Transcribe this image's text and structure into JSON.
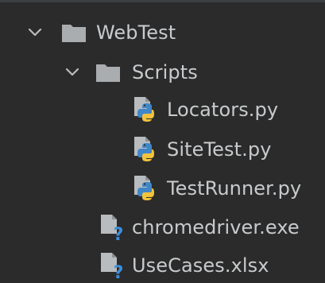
{
  "tree": {
    "root": {
      "label": "WebTest",
      "expanded": true,
      "icon": "folder-icon",
      "children": [
        {
          "label": "Scripts",
          "expanded": true,
          "icon": "folder-icon",
          "children": [
            {
              "label": "Locators.py",
              "icon": "python-file-icon"
            },
            {
              "label": "SiteTest.py",
              "icon": "python-file-icon"
            },
            {
              "label": "TestRunner.py",
              "icon": "python-file-icon"
            }
          ]
        },
        {
          "label": "chromedriver.exe",
          "icon": "unknown-file-icon"
        },
        {
          "label": "UseCases.xlsx",
          "icon": "unknown-file-icon"
        }
      ]
    }
  },
  "colors": {
    "background": "#2b2b2b",
    "text": "#c8cbcd",
    "folder": "#a9adb0",
    "python_blue": "#3f86c8",
    "python_yellow": "#f2c23b",
    "unknown_question": "#3e8ede"
  }
}
